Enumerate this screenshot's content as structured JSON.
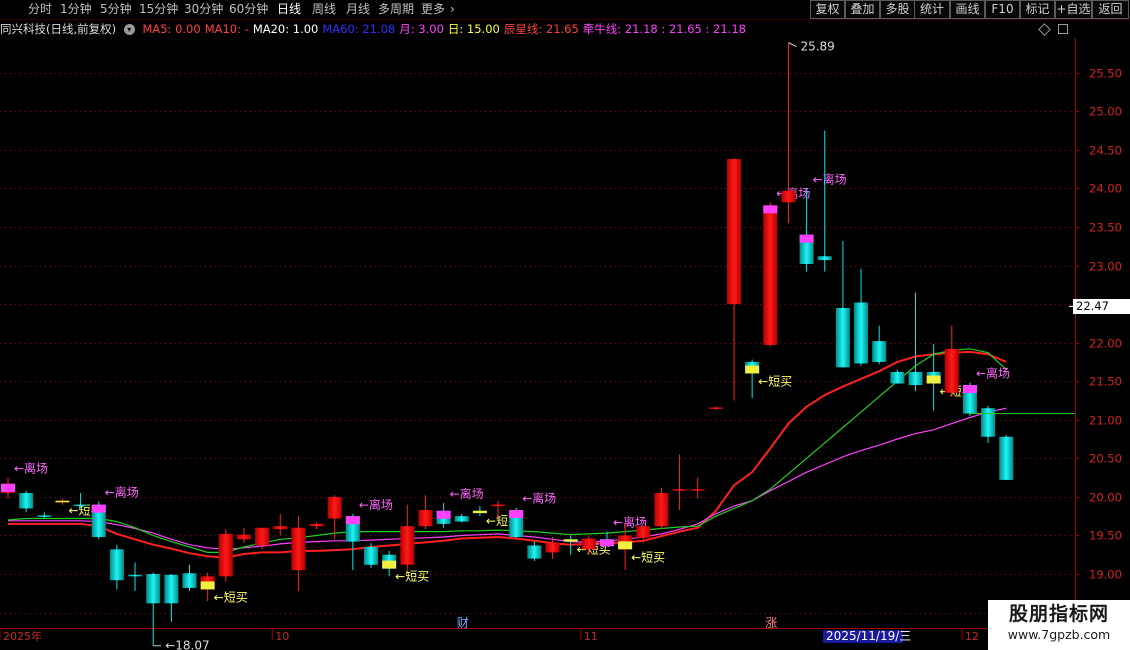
{
  "toolbar": {
    "periods": [
      "分时",
      "1分钟",
      "5分钟",
      "15分钟",
      "30分钟",
      "60分钟",
      "日线",
      "周线",
      "月线",
      "多周期",
      "更多"
    ],
    "active_period": "日线",
    "more_icon": "chevron-right-icon",
    "buttons": [
      "复权",
      "叠加",
      "多股",
      "统计",
      "画线",
      "F10",
      "标记",
      "+自选",
      "返回"
    ]
  },
  "infobar": {
    "title": "同兴科技(日线,前复权)",
    "collapse_icon": "chevron-down-circle-icon",
    "items": [
      {
        "text": "MA5: 0.00",
        "color": "#ff4040"
      },
      {
        "text": "MA10: -",
        "color": "#ff4040"
      },
      {
        "text": "MA20: 1.00",
        "color": "#ffffff"
      },
      {
        "text": "MA60: 21.08",
        "color": "#3030ff"
      },
      {
        "text": "月: 3.00",
        "color": "#ff40ff"
      },
      {
        "text": "日: 15.00",
        "color": "#ffff40"
      },
      {
        "text": "辰星线: 21.65",
        "color": "#ff4040"
      },
      {
        "text": "牵牛线: 21.18 : 21.65 : 21.18",
        "color": "#ff40ff"
      }
    ],
    "right_icons": [
      "diamond-icon",
      "square-icon"
    ]
  },
  "chart_data": {
    "type": "candlestick",
    "title": "同兴科技(日线,前复权)",
    "ylim": [
      18.3,
      25.95
    ],
    "y_ticks": [
      "25.50",
      "25.00",
      "24.50",
      "24.00",
      "23.50",
      "23.00",
      "22.50",
      "22.00",
      "21.50",
      "21.00",
      "20.50",
      "20.00",
      "19.50",
      "19.00",
      "18.50"
    ],
    "y_tick_values": [
      25.5,
      25.0,
      24.5,
      24.0,
      23.5,
      23.0,
      22.5,
      22.0,
      21.5,
      21.0,
      20.5,
      20.0,
      19.5,
      19.0,
      18.5
    ],
    "current_price": "22.47",
    "current_price_value": 22.47,
    "high_label": "25.89",
    "high_value": 25.89,
    "low_label": "18.07",
    "low_value": 18.07,
    "date_labels": [
      "2025年",
      "10",
      "11",
      "12"
    ],
    "date_label_index": [
      0,
      15,
      32,
      53
    ],
    "event_labels": [
      {
        "text": "财",
        "index": 25
      },
      {
        "text": "涨",
        "index": 42
      }
    ],
    "cursor_date": "2025/11/19/三",
    "cursor_index": 47,
    "colors": {
      "up": "#ff2020",
      "down": "#00e8e8",
      "axis": "#a00000",
      "grid": "#8b0000"
    },
    "candles": [
      {
        "o": 20.05,
        "h": 20.25,
        "l": 19.98,
        "c": 20.17,
        "tag": "exit"
      },
      {
        "o": 20.05,
        "h": 20.08,
        "l": 19.8,
        "c": 19.85
      },
      {
        "o": 19.76,
        "h": 19.8,
        "l": 19.72,
        "c": 19.74
      },
      {
        "o": 19.93,
        "h": 19.98,
        "l": 19.9,
        "c": 19.95,
        "tag": "short"
      },
      {
        "o": 19.9,
        "h": 20.05,
        "l": 19.85,
        "c": 19.88
      },
      {
        "o": 19.9,
        "h": 19.94,
        "l": 19.45,
        "c": 19.48,
        "tag": "exit"
      },
      {
        "o": 19.32,
        "h": 19.38,
        "l": 18.8,
        "c": 18.92
      },
      {
        "o": 18.99,
        "h": 19.15,
        "l": 18.78,
        "c": 18.97
      },
      {
        "o": 19.0,
        "h": 19.02,
        "l": 18.07,
        "c": 18.62
      },
      {
        "o": 18.99,
        "h": 19.0,
        "l": 18.38,
        "c": 18.62
      },
      {
        "o": 19.01,
        "h": 19.12,
        "l": 18.78,
        "c": 18.82
      },
      {
        "o": 18.8,
        "h": 19.02,
        "l": 18.65,
        "c": 18.97,
        "tag": "short"
      },
      {
        "o": 18.97,
        "h": 19.58,
        "l": 18.9,
        "c": 19.52
      },
      {
        "o": 19.45,
        "h": 19.6,
        "l": 19.4,
        "c": 19.51
      },
      {
        "o": 19.37,
        "h": 19.6,
        "l": 19.32,
        "c": 19.6
      },
      {
        "o": 19.58,
        "h": 19.78,
        "l": 19.5,
        "c": 19.62
      },
      {
        "o": 19.05,
        "h": 19.75,
        "l": 18.78,
        "c": 19.6
      },
      {
        "o": 19.62,
        "h": 19.67,
        "l": 19.58,
        "c": 19.65
      },
      {
        "o": 19.72,
        "h": 20.02,
        "l": 19.45,
        "c": 20.0
      },
      {
        "o": 19.75,
        "h": 19.78,
        "l": 19.05,
        "c": 19.42,
        "tag": "exit"
      },
      {
        "o": 19.35,
        "h": 19.4,
        "l": 19.08,
        "c": 19.12
      },
      {
        "o": 19.25,
        "h": 19.3,
        "l": 18.97,
        "c": 19.07,
        "tag": "short"
      },
      {
        "o": 19.12,
        "h": 19.9,
        "l": 19.06,
        "c": 19.62
      },
      {
        "o": 19.62,
        "h": 20.02,
        "l": 19.58,
        "c": 19.83
      },
      {
        "o": 19.82,
        "h": 19.92,
        "l": 19.6,
        "c": 19.65,
        "tag": "exit"
      },
      {
        "o": 19.75,
        "h": 19.78,
        "l": 19.67,
        "c": 19.68
      },
      {
        "o": 19.82,
        "h": 19.88,
        "l": 19.75,
        "c": 19.79,
        "tag": "short"
      },
      {
        "o": 19.88,
        "h": 19.95,
        "l": 19.72,
        "c": 19.9
      },
      {
        "o": 19.83,
        "h": 19.86,
        "l": 19.47,
        "c": 19.48,
        "tag": "exit"
      },
      {
        "o": 19.37,
        "h": 19.42,
        "l": 19.17,
        "c": 19.2
      },
      {
        "o": 19.28,
        "h": 19.48,
        "l": 19.2,
        "c": 19.4
      },
      {
        "o": 19.45,
        "h": 19.5,
        "l": 19.25,
        "c": 19.42,
        "tag": "short"
      },
      {
        "o": 19.32,
        "h": 19.5,
        "l": 19.25,
        "c": 19.46
      },
      {
        "o": 19.45,
        "h": 19.55,
        "l": 19.36,
        "c": 19.36,
        "tag": "exit"
      },
      {
        "o": 19.32,
        "h": 19.65,
        "l": 19.05,
        "c": 19.5,
        "tag": "short"
      },
      {
        "o": 19.47,
        "h": 19.62,
        "l": 19.4,
        "c": 19.62
      },
      {
        "o": 19.62,
        "h": 20.12,
        "l": 19.58,
        "c": 20.05
      },
      {
        "o": 20.08,
        "h": 20.55,
        "l": 19.83,
        "c": 20.1
      },
      {
        "o": 20.1,
        "h": 20.25,
        "l": 19.98,
        "c": 20.1
      },
      {
        "o": 21.15,
        "h": 21.17,
        "l": 21.13,
        "c": 21.16
      },
      {
        "o": 22.5,
        "h": 24.39,
        "l": 21.25,
        "c": 24.38
      },
      {
        "o": 21.75,
        "h": 21.78,
        "l": 21.28,
        "c": 21.6,
        "tag": "short"
      },
      {
        "o": 21.97,
        "h": 23.82,
        "l": 21.95,
        "c": 23.78,
        "tag": "exit"
      },
      {
        "o": 23.82,
        "h": 25.89,
        "l": 23.55,
        "c": 23.97
      },
      {
        "o": 23.4,
        "h": 24.0,
        "l": 22.92,
        "c": 23.02,
        "tag": "exit"
      },
      {
        "o": 23.12,
        "h": 24.75,
        "l": 22.92,
        "c": 23.07
      },
      {
        "o": 22.45,
        "h": 23.32,
        "l": 21.68,
        "c": 21.68
      },
      {
        "o": 22.52,
        "h": 22.96,
        "l": 21.7,
        "c": 21.73
      },
      {
        "o": 22.02,
        "h": 22.22,
        "l": 21.72,
        "c": 21.75
      },
      {
        "o": 21.62,
        "h": 21.65,
        "l": 21.47,
        "c": 21.47
      },
      {
        "o": 21.62,
        "h": 22.65,
        "l": 21.37,
        "c": 21.45
      },
      {
        "o": 21.62,
        "h": 21.98,
        "l": 21.12,
        "c": 21.47,
        "tag": "short"
      },
      {
        "o": 21.35,
        "h": 22.22,
        "l": 21.3,
        "c": 21.92
      },
      {
        "o": 21.45,
        "h": 21.48,
        "l": 21.05,
        "c": 21.08,
        "tag": "exit"
      },
      {
        "o": 21.15,
        "h": 21.18,
        "l": 20.7,
        "c": 20.78
      },
      {
        "o": 20.78,
        "h": 20.8,
        "l": 20.22,
        "c": 20.22
      }
    ],
    "series": [
      {
        "name": "MA60",
        "color": "#ff2020",
        "values": [
          19.65,
          19.65,
          19.65,
          19.65,
          19.65,
          19.62,
          19.52,
          19.45,
          19.38,
          19.33,
          19.27,
          19.23,
          19.21,
          19.26,
          19.28,
          19.28,
          19.3,
          19.3,
          19.31,
          19.32,
          19.35,
          19.37,
          19.39,
          19.41,
          19.43,
          19.46,
          19.47,
          19.48,
          19.46,
          19.43,
          19.4,
          19.38,
          19.39,
          19.4,
          19.41,
          19.43,
          19.49,
          19.55,
          19.6,
          19.82,
          20.15,
          20.32,
          20.63,
          20.95,
          21.17,
          21.32,
          21.43,
          21.53,
          21.63,
          21.75,
          21.82,
          21.85,
          21.87,
          21.88,
          21.85,
          21.75
        ]
      },
      {
        "name": "辰星线",
        "color": "#ff40ff",
        "values": [
          19.69,
          19.69,
          19.69,
          19.69,
          19.69,
          19.68,
          19.64,
          19.59,
          19.53,
          19.45,
          19.38,
          19.34,
          19.32,
          19.34,
          19.36,
          19.39,
          19.41,
          19.42,
          19.43,
          19.43,
          19.44,
          19.45,
          19.46,
          19.47,
          19.48,
          19.5,
          19.51,
          19.52,
          19.5,
          19.48,
          19.45,
          19.42,
          19.41,
          19.43,
          19.45,
          19.48,
          19.52,
          19.58,
          19.65,
          19.78,
          19.88,
          19.95,
          20.08,
          20.2,
          20.32,
          20.42,
          20.52,
          20.6,
          20.67,
          20.75,
          20.82,
          20.87,
          20.95,
          21.03,
          21.1,
          21.15
        ]
      },
      {
        "name": "牵牛线",
        "color": "#20d020",
        "values": [
          19.7,
          19.72,
          19.72,
          19.72,
          19.72,
          19.72,
          19.68,
          19.6,
          19.5,
          19.42,
          19.35,
          19.28,
          19.28,
          19.35,
          19.4,
          19.45,
          19.47,
          19.5,
          19.53,
          19.55,
          19.55,
          19.55,
          19.55,
          19.55,
          19.55,
          19.56,
          19.56,
          19.57,
          19.56,
          19.55,
          19.53,
          19.51,
          19.52,
          19.53,
          19.55,
          19.57,
          19.59,
          19.61,
          19.62,
          19.75,
          19.85,
          19.95,
          20.1,
          20.3,
          20.5,
          20.7,
          20.9,
          21.1,
          21.3,
          21.5,
          21.7,
          21.85,
          21.9,
          21.92,
          21.87,
          21.65
        ]
      }
    ],
    "annotations": {
      "exit": "←离场",
      "short": "←短买"
    }
  },
  "watermark": {
    "title": "股朋指标网",
    "url": "www.7gpzb.com"
  }
}
